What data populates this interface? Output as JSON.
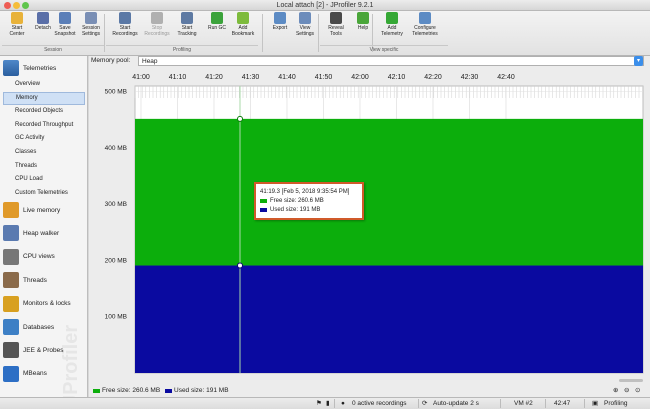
{
  "window": {
    "title": "Local attach [2] - JProfiler 9.2.1"
  },
  "toolbar": {
    "buttons": [
      {
        "label1": "Start",
        "label2": "Center",
        "icon": "start-center-icon",
        "color": "#e8b23a"
      },
      {
        "label1": "Detach",
        "label2": "",
        "icon": "detach-icon",
        "color": "#5a6fa8"
      },
      {
        "label1": "Save",
        "label2": "Snapshot",
        "icon": "save-snapshot-icon",
        "color": "#5b7fb8"
      },
      {
        "label1": "Session",
        "label2": "Settings",
        "icon": "session-settings-icon",
        "color": "#7a8fb5"
      },
      {
        "label1": "Start",
        "label2": "Recordings",
        "icon": "start-recordings-icon",
        "color": "#5b79a6"
      },
      {
        "label1": "Stop",
        "label2": "Recordings",
        "icon": "stop-recordings-icon",
        "color": "#b0b0b0"
      },
      {
        "label1": "Start",
        "label2": "Tracking",
        "icon": "start-tracking-icon",
        "color": "#5e7aa3"
      },
      {
        "label1": "Run GC",
        "label2": "",
        "icon": "run-gc-icon",
        "color": "#3ba33b"
      },
      {
        "label1": "Add",
        "label2": "Bookmark",
        "icon": "add-bookmark-icon",
        "color": "#7dbb3c"
      },
      {
        "label1": "Export",
        "label2": "",
        "icon": "export-icon",
        "color": "#5c8bc4"
      },
      {
        "label1": "View",
        "label2": "Settings",
        "icon": "view-settings-icon",
        "color": "#6c8cbb"
      },
      {
        "label1": "Reveal",
        "label2": "Tools",
        "icon": "reveal-tools-icon",
        "color": "#4a4a4a"
      },
      {
        "label1": "Help",
        "label2": "",
        "icon": "help-icon",
        "color": "#4aa63a"
      },
      {
        "label1": "Add",
        "label2": "Telemetry",
        "icon": "add-telemetry-icon",
        "color": "#35a835"
      },
      {
        "label1": "Configure",
        "label2": "Telemetries",
        "icon": "configure-telemetries-icon",
        "color": "#5c8bc4"
      }
    ],
    "groups": {
      "session": "Session",
      "profiling": "Profiling",
      "view_specific": "View specific"
    }
  },
  "sidebar": {
    "telemetries": "Telemetries",
    "subitems": [
      "Overview",
      "Memory",
      "Recorded Objects",
      "Recorded Throughput",
      "GC Activity",
      "Classes",
      "Threads",
      "CPU Load",
      "Custom Telemetries"
    ],
    "sections": [
      {
        "label": "Live memory",
        "icon": "live-memory-icon",
        "color": "#e09a2a"
      },
      {
        "label": "Heap walker",
        "icon": "heap-walker-icon",
        "color": "#5a7ab0"
      },
      {
        "label": "CPU views",
        "icon": "cpu-views-icon",
        "color": "#777777"
      },
      {
        "label": "Threads",
        "icon": "threads-icon",
        "color": "#8a6a4a"
      },
      {
        "label": "Monitors & locks",
        "icon": "monitors-locks-icon",
        "color": "#d8a020"
      },
      {
        "label": "Databases",
        "icon": "databases-icon",
        "color": "#3d7fc5"
      },
      {
        "label": "JEE & Probes",
        "icon": "jee-probes-icon",
        "color": "#555555"
      },
      {
        "label": "MBeans",
        "icon": "mbeans-icon",
        "color": "#2d6fc5"
      }
    ],
    "watermark": "JProfiler"
  },
  "main": {
    "pool_label": "Memory pool:",
    "pool_value": "Heap"
  },
  "chart_data": {
    "type": "area",
    "x_ticks": [
      "41:00",
      "41:10",
      "41:20",
      "41:30",
      "41:40",
      "41:50",
      "42:00",
      "42:10",
      "42:20",
      "42:30",
      "42:40"
    ],
    "y_ticks": [
      "100 MB",
      "200 MB",
      "300 MB",
      "400 MB",
      "500 MB"
    ],
    "ylim": [
      0,
      510
    ],
    "series": [
      {
        "name": "Used size",
        "value": 191,
        "color": "#0a0aa0"
      },
      {
        "name": "Free size",
        "value": 260.6,
        "color": "#0cae0c"
      }
    ],
    "cursor_x": "41:19.3"
  },
  "tooltip": {
    "title": "41:19.3 [Feb 5, 2018 9:35:54 PM]",
    "free": "Free size:  260.6 MB",
    "used": "Used size:  191 MB"
  },
  "legend": {
    "free": "Free size: 260.6 MB",
    "used": "Used size: 191 MB"
  },
  "status": {
    "recordings": "0 active recordings",
    "autoupdate": "Auto-update 2 s",
    "vm": "VM #2",
    "time": "42:47",
    "profiling": "Profiling"
  }
}
